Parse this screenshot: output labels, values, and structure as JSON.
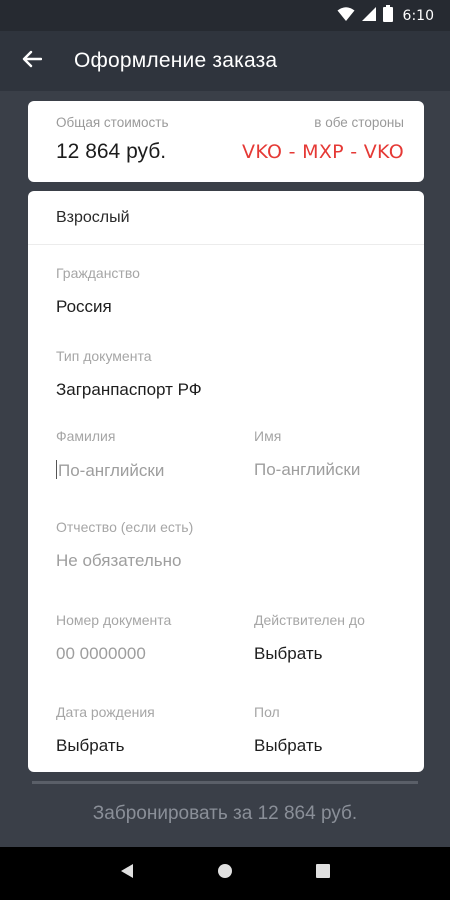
{
  "status_bar": {
    "time": "6:10",
    "icons": [
      "wifi-icon",
      "signal-icon",
      "battery-icon"
    ]
  },
  "app_bar": {
    "title": "Оформление заказа",
    "back_icon": "arrow-left-icon"
  },
  "price_card": {
    "total_label": "Общая стоимость",
    "direction_label": "в обе стороны",
    "total_value": "12 864 руб.",
    "route": "VKO - MXP - VKO",
    "route_color": "#e53935"
  },
  "passenger": {
    "type": "Взрослый",
    "citizenship": {
      "label": "Гражданство",
      "value": "Россия"
    },
    "document_type": {
      "label": "Тип документа",
      "value": "Загранпаспорт РФ"
    },
    "last_name": {
      "label": "Фамилия",
      "placeholder": "По-английски"
    },
    "first_name": {
      "label": "Имя",
      "placeholder": "По-английски"
    },
    "middle_name": {
      "label": "Отчество (если есть)",
      "placeholder": "Не обязательно"
    },
    "document_number": {
      "label": "Номер документа",
      "placeholder": "00 0000000"
    },
    "valid_until": {
      "label": "Действителен до",
      "value": "Выбрать"
    },
    "birth_date": {
      "label": "Дата рождения",
      "value": "Выбрать"
    },
    "gender": {
      "label": "Пол",
      "value": "Выбрать"
    }
  },
  "book_button": {
    "label": "Забронировать за 12 864 руб."
  },
  "nav_bar": {
    "icons": [
      "back-triangle-icon",
      "home-circle-icon",
      "recents-square-icon"
    ]
  }
}
